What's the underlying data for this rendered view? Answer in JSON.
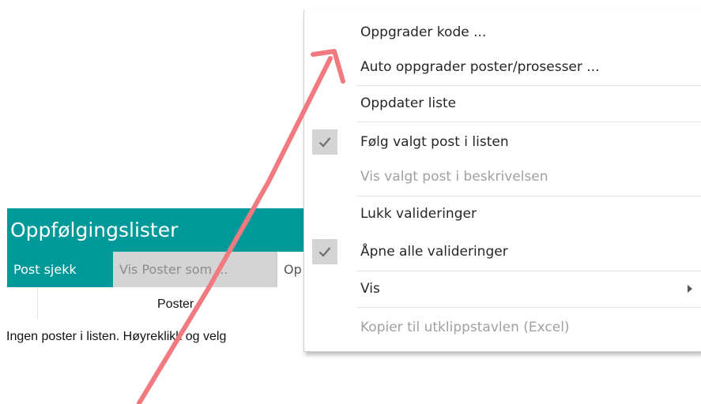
{
  "panel": {
    "title": "Oppfølgingslister",
    "tabs": [
      {
        "label": "Post sjekk"
      },
      {
        "label": "Vis Poster som ..."
      },
      {
        "label": "Op"
      }
    ],
    "list_header": "Poster",
    "empty_message": "Ingen poster i listen. Høyreklikk og velg"
  },
  "context_menu": {
    "items": [
      {
        "label": "Oppgrader kode ...",
        "enabled": true
      },
      {
        "label": "Auto oppgrader poster/prosesser ...",
        "enabled": true
      },
      {
        "label": "Oppdater liste",
        "enabled": true
      },
      {
        "label": "Følg valgt post i listen",
        "enabled": true,
        "checked": true
      },
      {
        "label": "Vis valgt post i beskrivelsen",
        "enabled": false
      },
      {
        "label": "Lukk valideringer",
        "enabled": true
      },
      {
        "label": "Åpne alle valideringer",
        "enabled": true,
        "checked": true
      },
      {
        "label": "Vis",
        "enabled": true,
        "submenu": true
      },
      {
        "label": "Kopier til utklippstavlen (Excel)",
        "enabled": false
      }
    ]
  },
  "colors": {
    "accent": "#009999",
    "annotation": "#f07a80",
    "disabled_text": "#a0a0a0",
    "checked_bg": "#d4d4d4"
  },
  "icons": {
    "check": "check-icon",
    "submenu": "chevron-right-icon"
  }
}
